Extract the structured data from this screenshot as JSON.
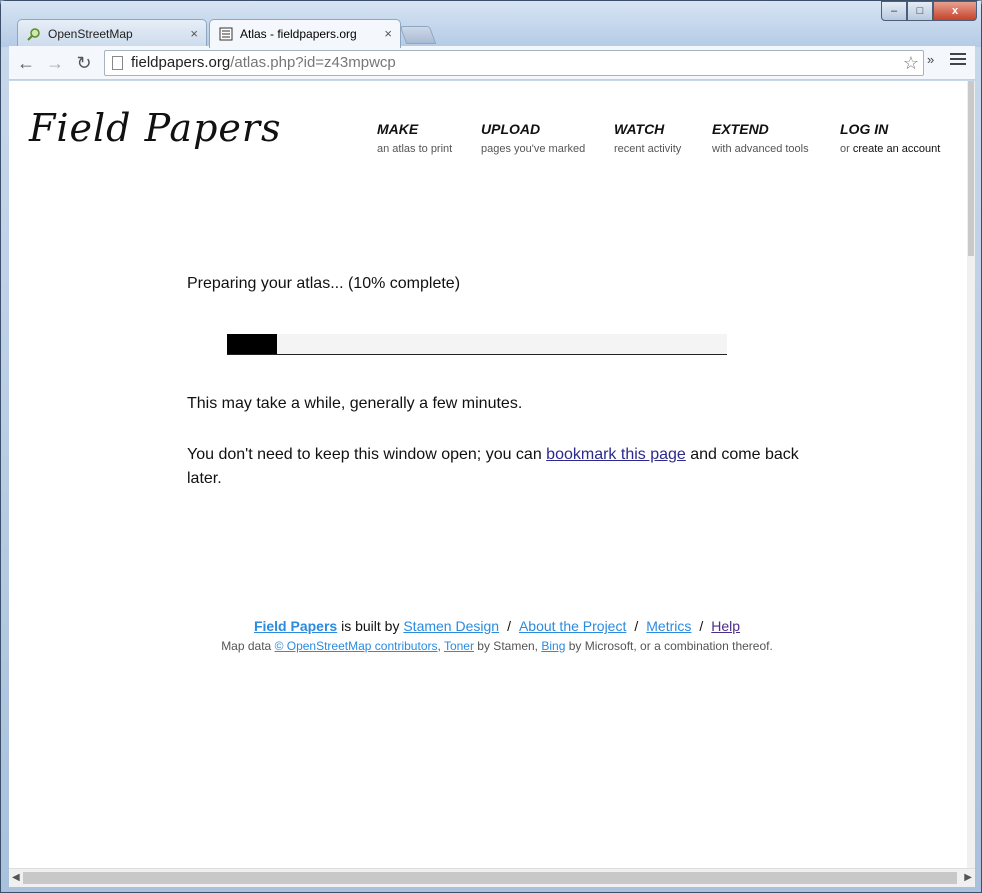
{
  "browser": {
    "tabs": [
      {
        "label": "OpenStreetMap",
        "close": "×"
      },
      {
        "label": "Atlas - fieldpapers.org",
        "close": "×"
      }
    ],
    "window_buttons": {
      "min": "–",
      "max": "□",
      "close": "x"
    },
    "address": {
      "host": "fieldpapers.org",
      "path": "/atlas.php?id=z43mpwcp"
    },
    "nav": {
      "back": "←",
      "forward": "→",
      "reload": "↻",
      "star": "☆",
      "more": "»"
    }
  },
  "site": {
    "logo": "Field Papers",
    "nav": [
      {
        "title": "MAKE",
        "subtitle": "an atlas to print"
      },
      {
        "title": "UPLOAD",
        "subtitle": "pages you've marked"
      },
      {
        "title": "WATCH",
        "subtitle": "recent activity"
      },
      {
        "title": "EXTEND",
        "subtitle": "with advanced tools"
      },
      {
        "title": "LOG IN",
        "subtitle_pre": "or ",
        "subtitle": "create an account"
      }
    ]
  },
  "content": {
    "status": "Preparing your atlas... (10% complete)",
    "progress_fraction": 0.1,
    "wait_note": "This may take a while, generally a few minutes.",
    "bookmark_pre": "You don't need to keep this window open; you can ",
    "bookmark_link": "bookmark this page",
    "bookmark_post": " and come back later."
  },
  "footer": {
    "brand": "Field Papers",
    "built_by": " is built by ",
    "stamen": "Stamen Design",
    "slash": "/",
    "about": "About the Project",
    "metrics": "Metrics",
    "help": "Help",
    "map_data": "Map data ",
    "osm": "© OpenStreetMap contributors",
    "comma": ", ",
    "toner": "Toner",
    "by_stamen": " by Stamen, ",
    "bing": "Bing",
    "by_microsoft": " by Microsoft, or a combination thereof."
  },
  "colors": {
    "link": "#2c2a8c",
    "footer_link": "#2a8be0",
    "progress_fill": "#000000"
  }
}
